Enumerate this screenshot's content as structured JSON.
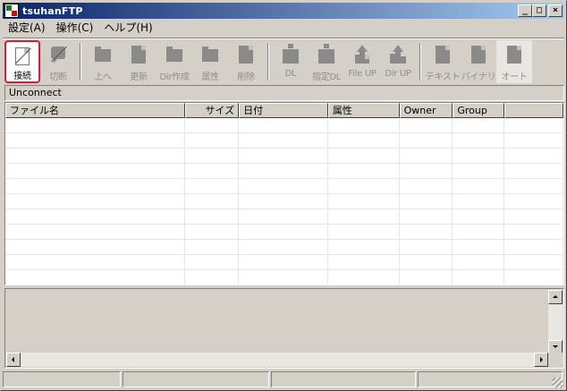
{
  "window": {
    "title": "tsuhanFTP"
  },
  "menu": [
    "設定(A)",
    "操作(C)",
    "ヘルプ(H)"
  ],
  "toolbar": {
    "connect": "接続",
    "disconnect": "切断",
    "up": "上へ",
    "refresh": "更新",
    "mkdir": "Dir作成",
    "attr": "属性",
    "delete": "削除",
    "dl": "DL",
    "dl_spec": "指定DL",
    "file_up": "File UP",
    "dir_up": "Dir UP",
    "text": "テキスト",
    "binary": "バイナリ",
    "auto": "オート"
  },
  "connection_status": "Unconnect",
  "file_list": {
    "columns": [
      "ファイル名",
      "サイズ",
      "日付",
      "属性",
      "Owner",
      "Group"
    ],
    "rows": []
  },
  "colors": {
    "titlebar_start": "#0a246a",
    "titlebar_end": "#a6caf0",
    "highlight_border": "#d61d3e",
    "face": "#d4d0c8"
  }
}
